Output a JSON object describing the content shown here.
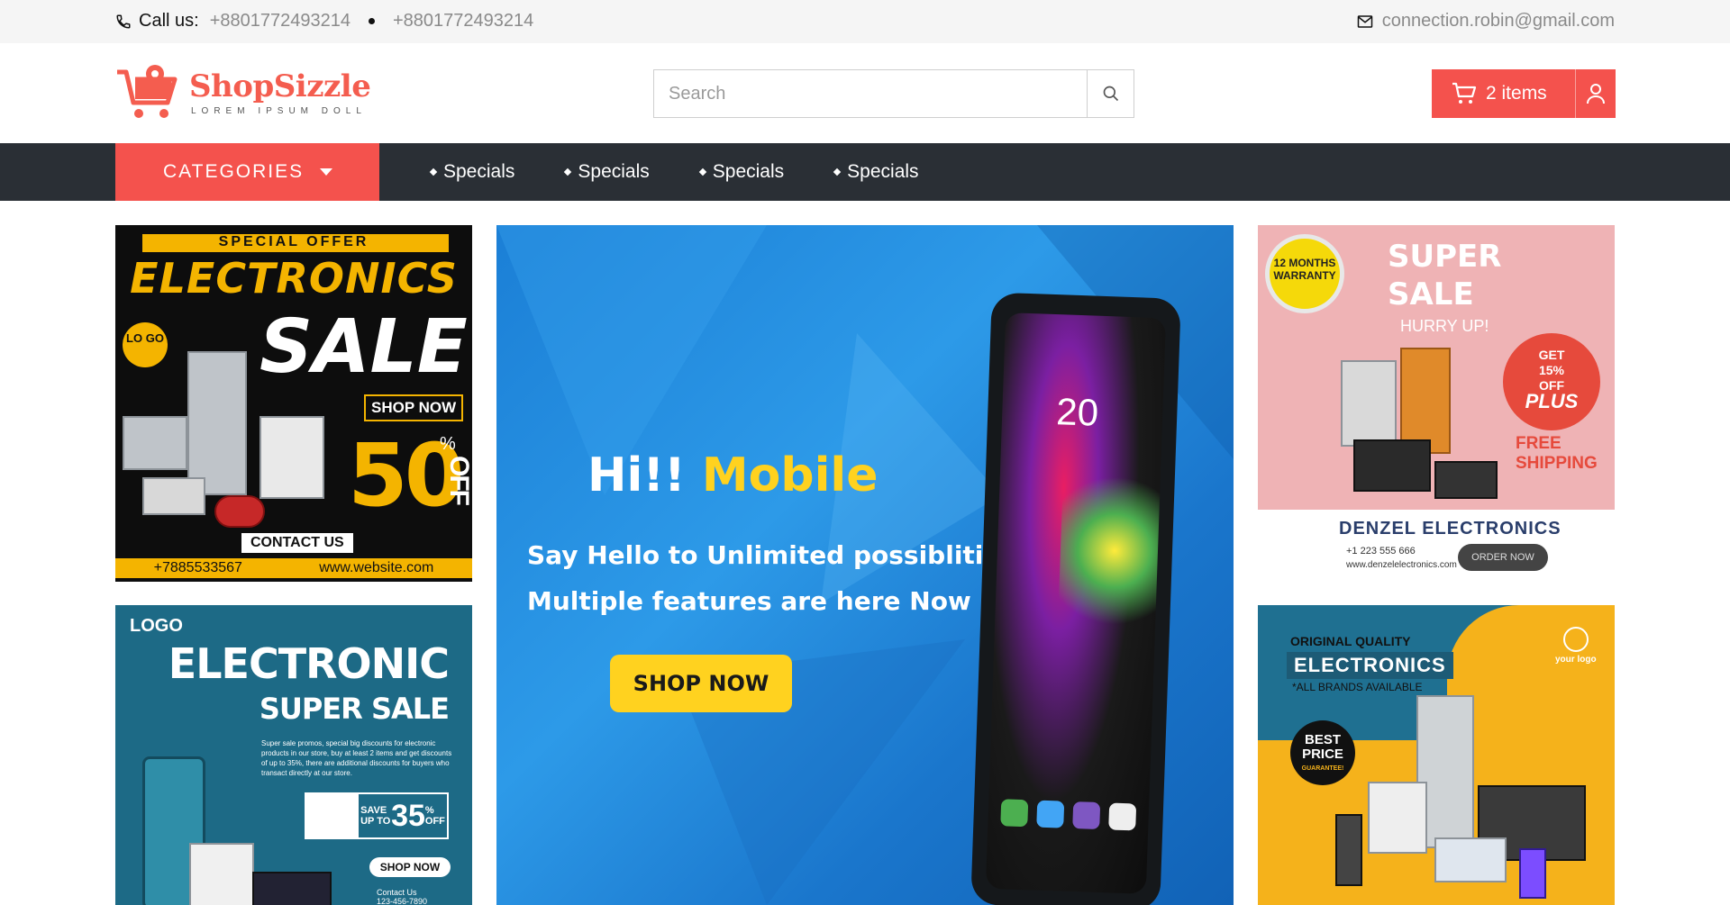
{
  "topbar": {
    "call_label": "Call us:",
    "phone_1": "+8801772493214",
    "phone_2": "+8801772493214",
    "email": "connection.robin@gmail.com"
  },
  "header": {
    "brand_name": "ShopSizzle",
    "tagline": "LOREM IPSUM DOLL",
    "search_placeholder": "Search",
    "cart_label": "2 items"
  },
  "navbar": {
    "categories_label": "CATEGORIES",
    "links": [
      "Specials",
      "Specials",
      "Specials",
      "Specials"
    ]
  },
  "banners": {
    "left_top": {
      "special_offer": "SPECIAL OFFER",
      "electronics": "ELECTRONICS",
      "sale": "SALE",
      "logo": "LO GO",
      "shop_now": "SHOP NOW",
      "discount": "50",
      "percent": "%",
      "off": "OFF",
      "contact": "CONTACT US",
      "phone": "+7885533567",
      "website": "www.website.com"
    },
    "center": {
      "hi": "Hi!!",
      "mobile": "Mobile",
      "line1": "Say Hello to Unlimited possiblities",
      "line2": "Multiple features are here Now",
      "shop_now": "SHOP NOW",
      "phone_time": "20"
    },
    "right_top": {
      "warranty": "12 MONTHS WARRANTY",
      "super": "SUPER",
      "sale": "SALE",
      "hurry": "HURRY UP!",
      "get": "GET",
      "percent": "15%",
      "off": "OFF",
      "plus": "PLUS",
      "free": "FREE",
      "shipping": "SHIPPING",
      "brand": "DENZEL ELECTRONICS",
      "phone": "+1 223 555 666",
      "website": "www.denzelelectronics.com",
      "order_now": "ORDER NOW"
    },
    "left_bottom": {
      "logo": "LOGO",
      "electronic": "ELECTRONIC",
      "super_sale": "SUPER SALE",
      "description": "Super sale promos, special big discounts for electronic products in our store, buy at least 2 items and get discounts of up to 35%, there are additional discounts for buyers who transact directly at our store.",
      "save": "SAVE UP TO",
      "discount": "35",
      "percent": "%",
      "off": "OFF",
      "shop_now": "SHOP NOW",
      "contact_label": "Contact Us",
      "contact_phone": "123-456-7890"
    },
    "right_bottom": {
      "original": "ORIGINAL QUALITY",
      "electronics": "ELECTRONICS",
      "all_brands": "*ALL BRANDS AVAILABLE",
      "best": "BEST",
      "price": "PRICE",
      "guarantee": "GUARANTEE!",
      "your_logo": "your logo"
    }
  },
  "colors": {
    "accent": "#f4524d",
    "nav_bg": "#2a2f35",
    "topbar_bg": "#f5f5f5"
  }
}
